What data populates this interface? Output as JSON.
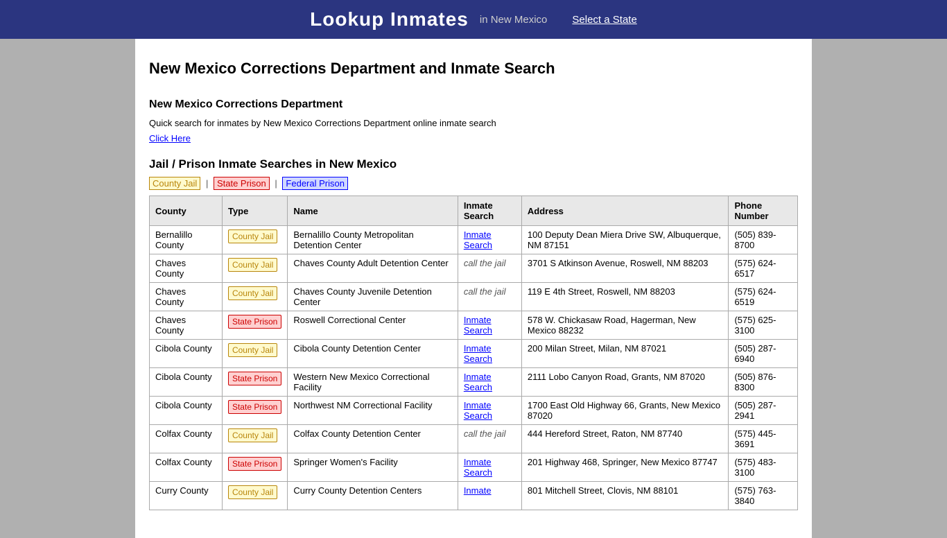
{
  "header": {
    "title": "Lookup Inmates",
    "subtitle": "in New Mexico",
    "select_state": "Select a State"
  },
  "page": {
    "title": "New Mexico Corrections Department and Inmate Search",
    "dept_section_title": "New Mexico Corrections Department",
    "dept_desc": "Quick search for inmates by New Mexico Corrections Department online inmate search",
    "click_here": "Click Here",
    "jail_section_title": "Jail / Prison Inmate Searches in New Mexico"
  },
  "legend": {
    "county": "County Jail",
    "state": "State Prison",
    "federal": "Federal Prison",
    "sep1": "|",
    "sep2": "|"
  },
  "table": {
    "headers": [
      "County",
      "Type",
      "Name",
      "Inmate Search",
      "Address",
      "Phone Number"
    ],
    "rows": [
      {
        "county": "Bernalillo County",
        "type": "county",
        "type_label": "County Jail",
        "name": "Bernalillo County Metropolitan Detention Center",
        "inmate_search": "Inmate Search",
        "address": "100 Deputy Dean Miera Drive SW, Albuquerque, NM 87151",
        "phone": "(505) 839-8700"
      },
      {
        "county": "Chaves County",
        "type": "county",
        "type_label": "County Jail",
        "name": "Chaves County Adult Detention Center",
        "inmate_search": "call the jail",
        "address": "3701 S Atkinson Avenue, Roswell, NM 88203",
        "phone": "(575) 624-6517"
      },
      {
        "county": "Chaves County",
        "type": "county",
        "type_label": "County Jail",
        "name": "Chaves County Juvenile Detention Center",
        "inmate_search": "call the jail",
        "address": "119 E 4th Street, Roswell, NM 88203",
        "phone": "(575) 624-6519"
      },
      {
        "county": "Chaves County",
        "type": "state",
        "type_label": "State Prison",
        "name": "Roswell Correctional Center",
        "inmate_search": "Inmate Search",
        "address": "578 W. Chickasaw Road, Hagerman, New Mexico 88232",
        "phone": "(575) 625-3100"
      },
      {
        "county": "Cibola County",
        "type": "county",
        "type_label": "County Jail",
        "name": "Cibola County Detention Center",
        "inmate_search": "Inmate Search",
        "address": "200 Milan Street, Milan, NM 87021",
        "phone": "(505) 287-6940"
      },
      {
        "county": "Cibola County",
        "type": "state",
        "type_label": "State Prison",
        "name": "Western New Mexico Correctional Facility",
        "inmate_search": "Inmate Search",
        "address": "2111 Lobo Canyon Road, Grants, NM 87020",
        "phone": "(505) 876-8300"
      },
      {
        "county": "Cibola County",
        "type": "state",
        "type_label": "State Prison",
        "name": "Northwest NM Correctional Facility",
        "inmate_search": "Inmate Search",
        "address": "1700 East Old Highway 66, Grants, New Mexico 87020",
        "phone": "(505) 287-2941"
      },
      {
        "county": "Colfax County",
        "type": "county",
        "type_label": "County Jail",
        "name": "Colfax County Detention Center",
        "inmate_search": "call the jail",
        "address": "444 Hereford Street, Raton, NM 87740",
        "phone": "(575) 445-3691"
      },
      {
        "county": "Colfax County",
        "type": "state",
        "type_label": "State Prison",
        "name": "Springer Women's Facility",
        "inmate_search": "Inmate Search",
        "address": "201 Highway 468, Springer, New Mexico 87747",
        "phone": "(575) 483-3100"
      },
      {
        "county": "Curry County",
        "type": "county",
        "type_label": "County Jail",
        "name": "Curry County Detention Centers",
        "inmate_search": "Inmate",
        "address": "801 Mitchell Street, Clovis, NM 88101",
        "phone": "(575) 763-3840"
      }
    ]
  }
}
